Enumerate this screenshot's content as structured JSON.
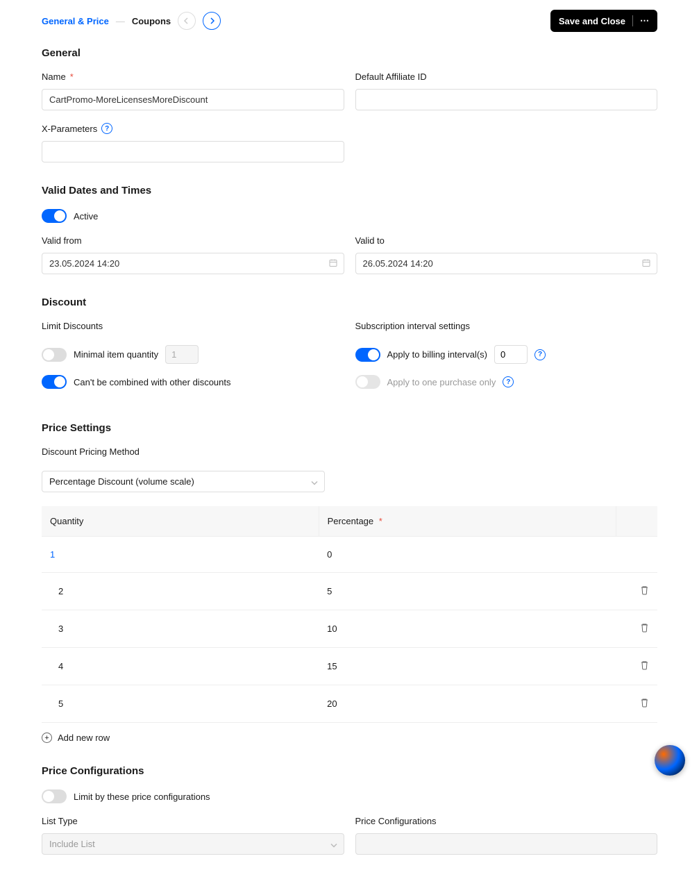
{
  "breadcrumb": {
    "step1": "General & Price",
    "step2": "Coupons"
  },
  "actions": {
    "save": "Save and Close"
  },
  "sections": {
    "general": "General",
    "validDates": "Valid Dates and Times",
    "discount": "Discount",
    "priceSettings": "Price Settings",
    "priceConfigs": "Price Configurations"
  },
  "fields": {
    "name": {
      "label": "Name",
      "value": "CartPromo-MoreLicensesMoreDiscount"
    },
    "affiliateId": {
      "label": "Default Affiliate ID",
      "value": ""
    },
    "xparams": {
      "label": "X-Parameters",
      "value": ""
    },
    "active": {
      "label": "Active"
    },
    "validFrom": {
      "label": "Valid from",
      "value": "23.05.2024 14:20"
    },
    "validTo": {
      "label": "Valid to",
      "value": "26.05.2024 14:20"
    },
    "limitDiscounts": {
      "label": "Limit Discounts"
    },
    "minItemQty": {
      "label": "Minimal item quantity",
      "value": "1"
    },
    "noCombine": {
      "label": "Can't be combined with other discounts"
    },
    "subInterval": {
      "label": "Subscription interval settings"
    },
    "applyBilling": {
      "label": "Apply to billing interval(s)",
      "value": "0"
    },
    "applyOne": {
      "label": "Apply to one purchase only"
    },
    "pricingMethod": {
      "label": "Discount Pricing Method",
      "value": "Percentage Discount (volume scale)"
    },
    "limitPriceConf": {
      "label": "Limit by these price configurations"
    },
    "listType": {
      "label": "List Type",
      "value": "Include List"
    },
    "priceConfSelect": {
      "label": "Price Configurations"
    }
  },
  "table": {
    "headers": {
      "quantity": "Quantity",
      "percentage": "Percentage"
    },
    "rows": [
      {
        "quantity": "1",
        "percentage": "0"
      },
      {
        "quantity": "2",
        "percentage": "5"
      },
      {
        "quantity": "3",
        "percentage": "10"
      },
      {
        "quantity": "4",
        "percentage": "15"
      },
      {
        "quantity": "5",
        "percentage": "20"
      }
    ],
    "addNew": "Add new row"
  }
}
